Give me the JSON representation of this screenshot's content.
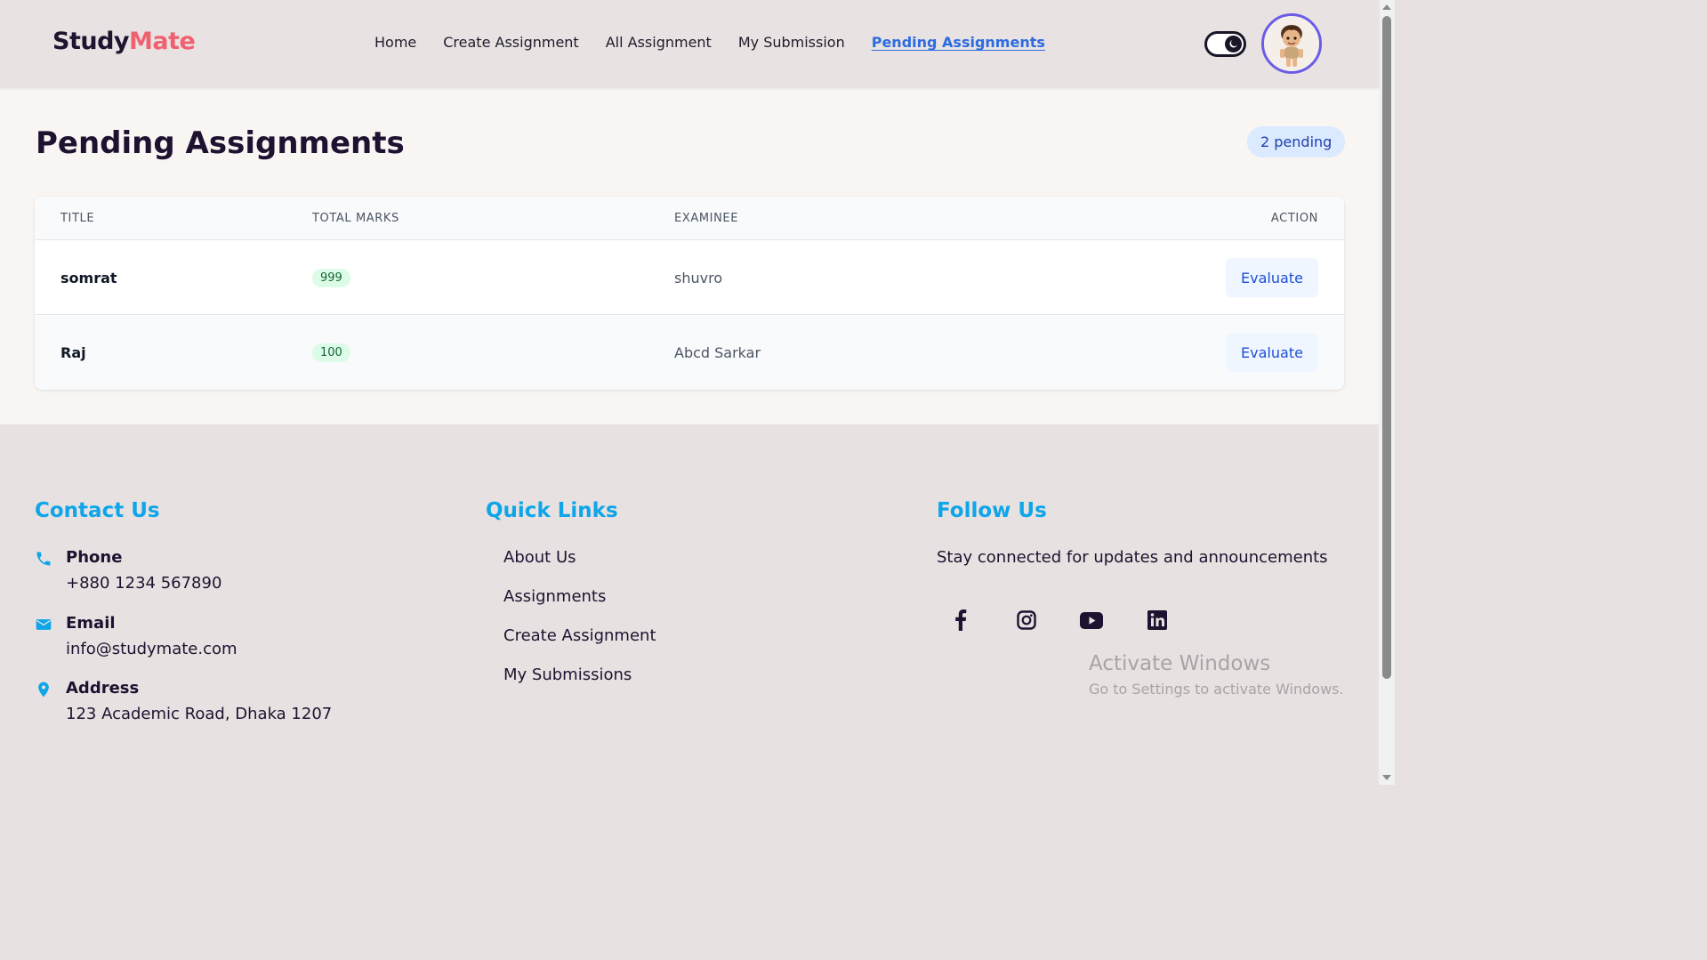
{
  "brand": {
    "part1": "Study",
    "part2": "Mate"
  },
  "nav": {
    "items": [
      {
        "label": "Home"
      },
      {
        "label": "Create Assignment"
      },
      {
        "label": "All Assignment"
      },
      {
        "label": "My Submission"
      },
      {
        "label": "Pending Assignments",
        "active": true
      }
    ]
  },
  "page": {
    "title": "Pending Assignments",
    "badge": "2 pending"
  },
  "table": {
    "headers": {
      "title": "TITLE",
      "marks": "TOTAL MARKS",
      "examinee": "EXAMINEE",
      "action": "ACTION"
    },
    "rows": [
      {
        "title": "somrat",
        "marks": "999",
        "examinee": "shuvro",
        "action": "Evaluate"
      },
      {
        "title": "Raj",
        "marks": "100",
        "examinee": "Abcd Sarkar",
        "action": "Evaluate"
      }
    ]
  },
  "footer": {
    "contact": {
      "heading": "Contact Us",
      "phone_label": "Phone",
      "phone": "+880 1234 567890",
      "email_label": "Email",
      "email": "info@studymate.com",
      "address_label": "Address",
      "address": "123 Academic Road, Dhaka 1207"
    },
    "quick_links": {
      "heading": "Quick Links",
      "items": [
        "About Us",
        "Assignments",
        "Create Assignment",
        "My Submissions"
      ]
    },
    "follow": {
      "heading": "Follow Us",
      "text": "Stay connected for updates and announcements",
      "icons": [
        "facebook-icon",
        "instagram-icon",
        "youtube-icon",
        "linkedin-icon"
      ]
    }
  },
  "watermark": {
    "line1": "Activate Windows",
    "line2": "Go to Settings to activate Windows."
  },
  "colors": {
    "accent": "#0ea5e9",
    "brand": "#f0616f",
    "active_link": "#2d6be0"
  }
}
